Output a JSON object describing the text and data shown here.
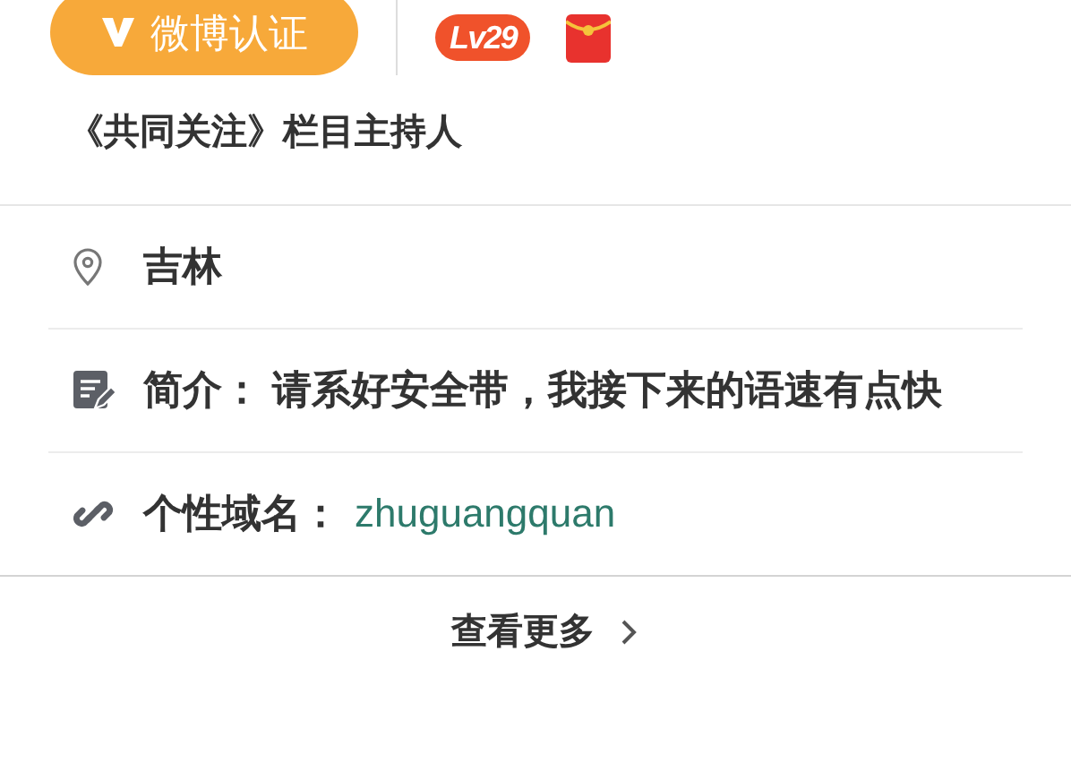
{
  "verification_badge": {
    "label": "微博认证"
  },
  "level_badge": {
    "label": "Lv29"
  },
  "title": "《共同关注》栏目主持人",
  "details": [
    {
      "kind": "location",
      "value": "吉林"
    },
    {
      "kind": "bio",
      "label": "简介：",
      "value": "请系好安全带，我接下来的语速有点快"
    },
    {
      "kind": "domain",
      "label": "个性域名：",
      "value": "zhuguangquan"
    }
  ],
  "more_link": {
    "label": "查看更多"
  }
}
